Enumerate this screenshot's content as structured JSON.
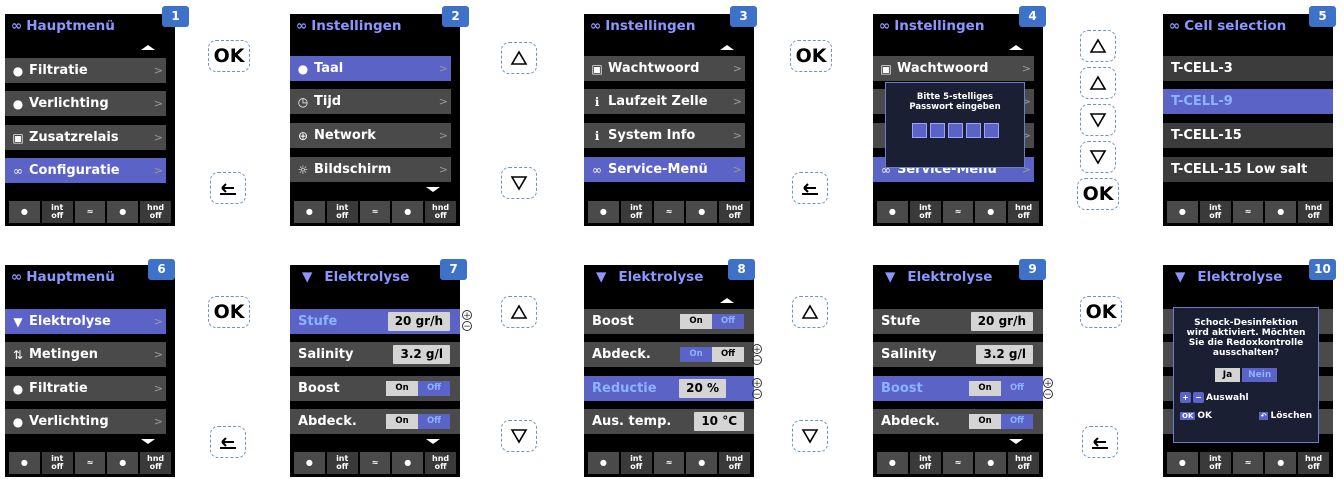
{
  "footer": {
    "int": "int",
    "off": "off",
    "hnd": "hnd"
  },
  "ok_label": "OK",
  "screens": {
    "s1": {
      "badge": "1",
      "title": "Hauptmenü",
      "rows": [
        "Filtratie",
        "Verlichting",
        "Zusatzrelais",
        "Configuratie"
      ]
    },
    "s2": {
      "badge": "2",
      "title": "Instellingen",
      "rows": [
        "Taal",
        "Tijd",
        "Network",
        "Bildschirm"
      ]
    },
    "s3": {
      "badge": "3",
      "title": "Instellingen",
      "rows": [
        "Wachtwoord",
        "Laufzeit Zelle",
        "System Info",
        "Service-Menü"
      ]
    },
    "s4": {
      "badge": "4",
      "title": "Instellingen",
      "rows": [
        "Wachtwoord",
        "Service-Menü"
      ],
      "popup": {
        "line1": "Bitte 5-stelliges",
        "line2": "Passwort eingeben"
      }
    },
    "s5": {
      "badge": "5",
      "title": "Cell selection",
      "rows": [
        "T-CELL-3",
        "T-CELL-9",
        "T-CELL-15",
        "T-CELL-15 Low salt"
      ]
    },
    "s6": {
      "badge": "6",
      "title": "Hauptmenü",
      "rows": [
        "Elektrolyse",
        "Metingen",
        "Filtratie",
        "Verlichting"
      ]
    },
    "s7": {
      "badge": "7",
      "title": "Elektrolyse",
      "rows": [
        {
          "label": "Stufe",
          "value": "20 gr/h"
        },
        {
          "label": "Salinity",
          "value": "3.2 g/l"
        },
        {
          "label": "Boost",
          "on": "On",
          "off": "Off"
        },
        {
          "label": "Abdeck.",
          "on": "On",
          "off": "Off"
        }
      ]
    },
    "s8": {
      "badge": "8",
      "title": "Elektrolyse",
      "rows": [
        {
          "label": "Boost",
          "on": "On",
          "off": "Off"
        },
        {
          "label": "Abdeck.",
          "on": "On",
          "off": "Off"
        },
        {
          "label": "Reductie",
          "value": "20 %"
        },
        {
          "label": "Aus. temp.",
          "value": "10 °C"
        }
      ]
    },
    "s9": {
      "badge": "9",
      "title": "Elektrolyse",
      "rows": [
        {
          "label": "Stufe",
          "value": "20 gr/h"
        },
        {
          "label": "Salinity",
          "value": "3.2 g/l"
        },
        {
          "label": "Boost",
          "on": "On",
          "off": "Off"
        },
        {
          "label": "Abdeck.",
          "on": "On",
          "off": "Off"
        }
      ]
    },
    "s10": {
      "badge": "10",
      "title": "Elektrolyse",
      "popup": {
        "line1": "Schock-Desinfektion",
        "line2": "wird aktiviert. Möchten",
        "line3": "Sie die Redoxkontrolle",
        "line4": "ausschalten?",
        "yes": "Ja",
        "no": "Nein",
        "select": "Auswahl",
        "ok": "OK",
        "delete": "Löschen"
      }
    }
  },
  "colors": {
    "selected": "#5b63c7",
    "title": "#8c96ff",
    "badge": "#3d72c8"
  }
}
